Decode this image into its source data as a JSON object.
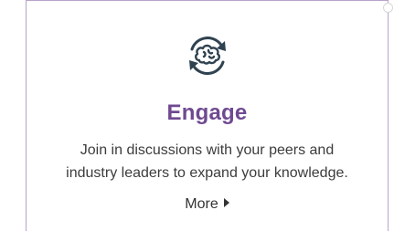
{
  "card": {
    "title": "Engage",
    "description_line1": "Join in discussions with your peers and",
    "description_line2": "industry leaders to expand your knowledge.",
    "more_label": "More",
    "icon": "engage-brain-cycle-icon"
  },
  "colors": {
    "title": "#6f4a91",
    "border": "#b8a4c8",
    "icon_stroke": "#2f4250",
    "text": "#3c3c3c"
  }
}
